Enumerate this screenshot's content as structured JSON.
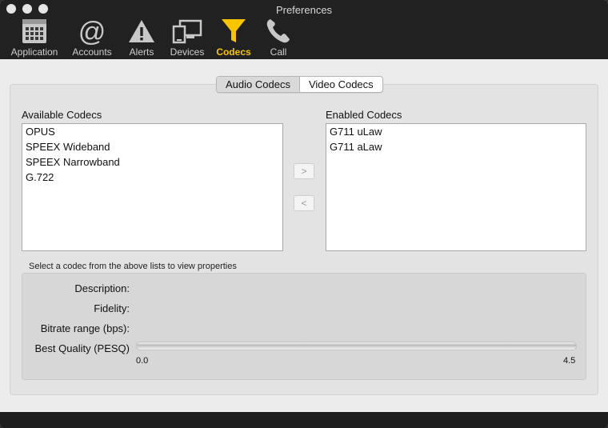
{
  "window": {
    "title": "Preferences"
  },
  "toolbar": {
    "items": [
      {
        "label": "Application",
        "icon": "calendar-grid-icon"
      },
      {
        "label": "Accounts",
        "icon": "at-sign-icon"
      },
      {
        "label": "Alerts",
        "icon": "warning-triangle-icon"
      },
      {
        "label": "Devices",
        "icon": "devices-icon"
      },
      {
        "label": "Codecs",
        "icon": "funnel-icon",
        "active": true
      },
      {
        "label": "Call",
        "icon": "phone-icon"
      }
    ],
    "active_color": "#f7c500"
  },
  "tabs": {
    "audio": "Audio Codecs",
    "video": "Video Codecs",
    "selected": "Audio Codecs"
  },
  "available": {
    "title": "Available Codecs",
    "items": [
      "OPUS",
      "SPEEX Wideband",
      "SPEEX Narrowband",
      "G.722"
    ]
  },
  "enabled": {
    "title": "Enabled Codecs",
    "items": [
      "G711 uLaw",
      "G711 aLaw"
    ]
  },
  "buttons": {
    "add": ">",
    "remove": "<"
  },
  "hint": "Select a codec from the above lists to view properties",
  "properties": {
    "description_label": "Description:",
    "fidelity_label": "Fidelity:",
    "bitrate_label": "Bitrate range (bps):",
    "quality_label": "Best Quality (PESQ)",
    "quality_min": "0.0",
    "quality_max": "4.5"
  }
}
